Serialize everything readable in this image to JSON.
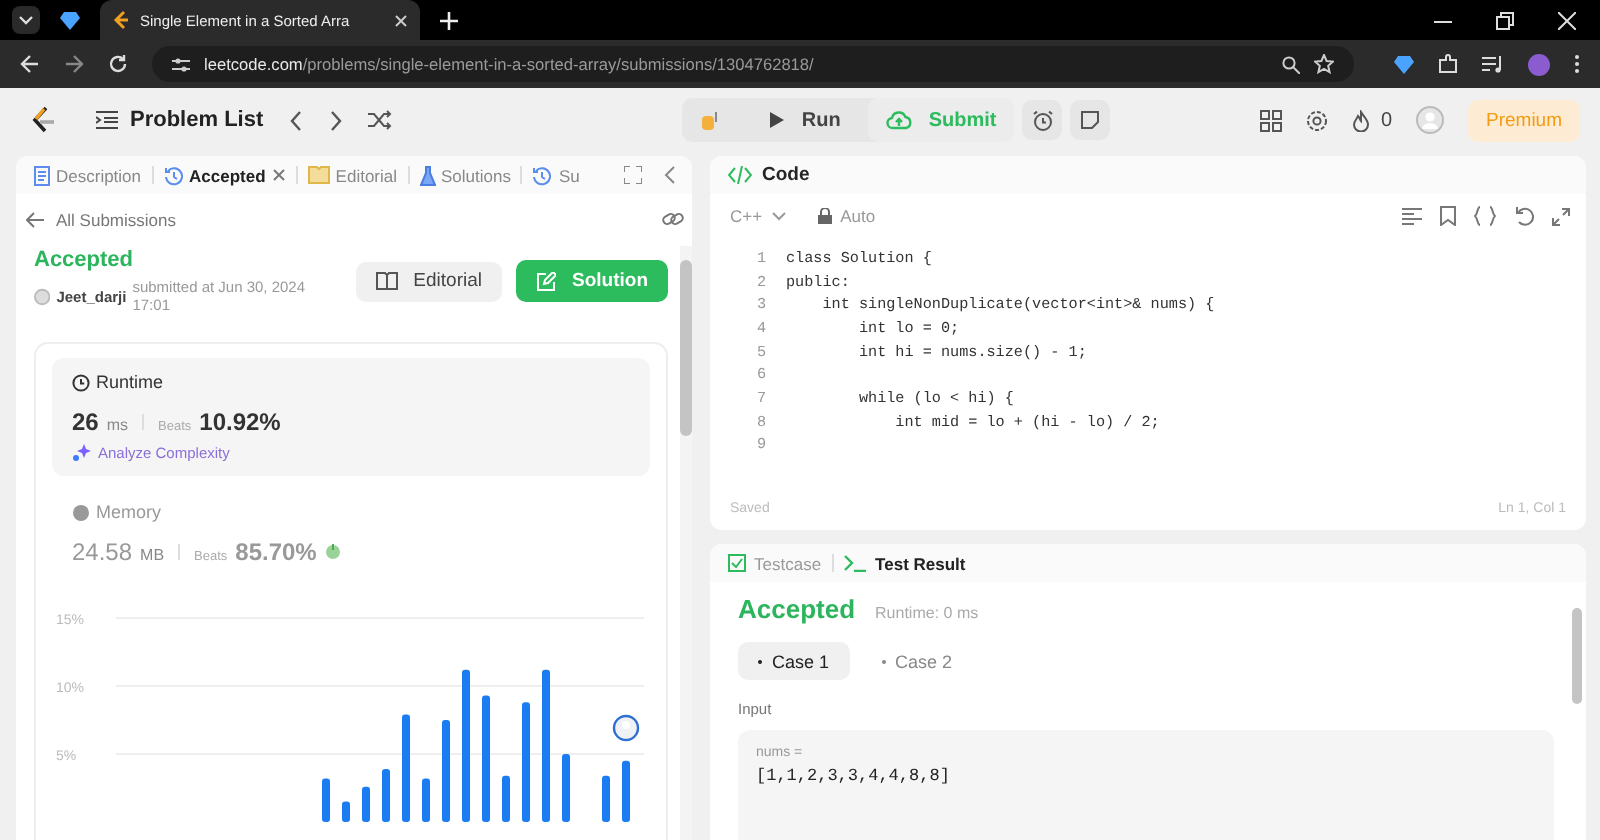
{
  "browser": {
    "tab_title": "Single Element in a Sorted Arra",
    "url_host": "leetcode.com",
    "url_path": "/problems/single-element-in-a-sorted-array/submissions/1304762818/"
  },
  "nav": {
    "problem_list": "Problem List",
    "run": "Run",
    "submit": "Submit",
    "streak": "0",
    "premium": "Premium"
  },
  "left_tabs": [
    {
      "label": "Description",
      "kind": "doc",
      "selected": false,
      "closable": false
    },
    {
      "label": "Accepted",
      "kind": "history",
      "selected": true,
      "closable": true
    },
    {
      "label": "Editorial",
      "kind": "book",
      "selected": false,
      "closable": false
    },
    {
      "label": "Solutions",
      "kind": "flask",
      "selected": false,
      "closable": false
    },
    {
      "label": "Su",
      "kind": "history",
      "selected": false,
      "closable": false
    }
  ],
  "back_link": "All Submissions",
  "submission": {
    "status": "Accepted",
    "user": "Jeet_darji",
    "submitted": "submitted at Jun 30, 2024 17:01",
    "editorial_button": "Editorial",
    "solution_button": "Solution"
  },
  "stats": [
    {
      "kind": "runtime",
      "label": "Runtime",
      "value": "26",
      "unit": "ms",
      "beats_label": "Beats",
      "beats": "10.92%",
      "selected": true,
      "action": "Analyze Complexity"
    },
    {
      "kind": "memory",
      "label": "Memory",
      "value": "24.58",
      "unit": "MB",
      "beats_label": "Beats",
      "beats": "85.70%",
      "selected": false
    }
  ],
  "chart_data": {
    "type": "bar",
    "ylim": [
      0,
      15
    ],
    "yticks": [
      {
        "value": 5,
        "label": "5%"
      },
      {
        "value": 10,
        "label": "10%"
      },
      {
        "value": 15,
        "label": "15%"
      }
    ],
    "values": [
      null,
      null,
      null,
      null,
      null,
      null,
      null,
      null,
      null,
      null,
      3.2,
      1.5,
      2.6,
      3.9,
      7.9,
      3.2,
      7.5,
      11.2,
      9.3,
      3.4,
      8.8,
      11.2,
      5.0,
      null,
      3.4,
      4.5
    ]
  },
  "editor": {
    "title": "Code",
    "language": "C++",
    "mode": "Auto",
    "status": "Saved",
    "cursor": "Ln 1, Col 1",
    "lines": [
      {
        "number": "1",
        "code": "class Solution {"
      },
      {
        "number": "2",
        "code": "public:"
      },
      {
        "number": "3",
        "code": "    int singleNonDuplicate(vector<int>& nums) {"
      },
      {
        "number": "4",
        "code": "        int lo = 0;"
      },
      {
        "number": "5",
        "code": "        int hi = nums.size() - 1;"
      },
      {
        "number": "6"
      },
      {
        "number": "7",
        "code": "        while (lo < hi) {"
      },
      {
        "number": "8",
        "code": "            int mid = lo + (hi - lo) / 2;"
      },
      {
        "number": "9"
      }
    ]
  },
  "console": {
    "tabs": [
      {
        "label": "Testcase",
        "kind": "check",
        "selected": false
      },
      {
        "label": "Test Result",
        "kind": "terminal",
        "selected": true
      }
    ],
    "verdict": "Accepted",
    "runtime": "Runtime: 0 ms",
    "cases": [
      {
        "label": "Case 1",
        "selected": true
      },
      {
        "label": "Case 2",
        "selected": false
      }
    ],
    "input_label": "Input",
    "input_name": "nums =",
    "input_value": "[1,1,2,3,3,4,4,8,8]"
  }
}
